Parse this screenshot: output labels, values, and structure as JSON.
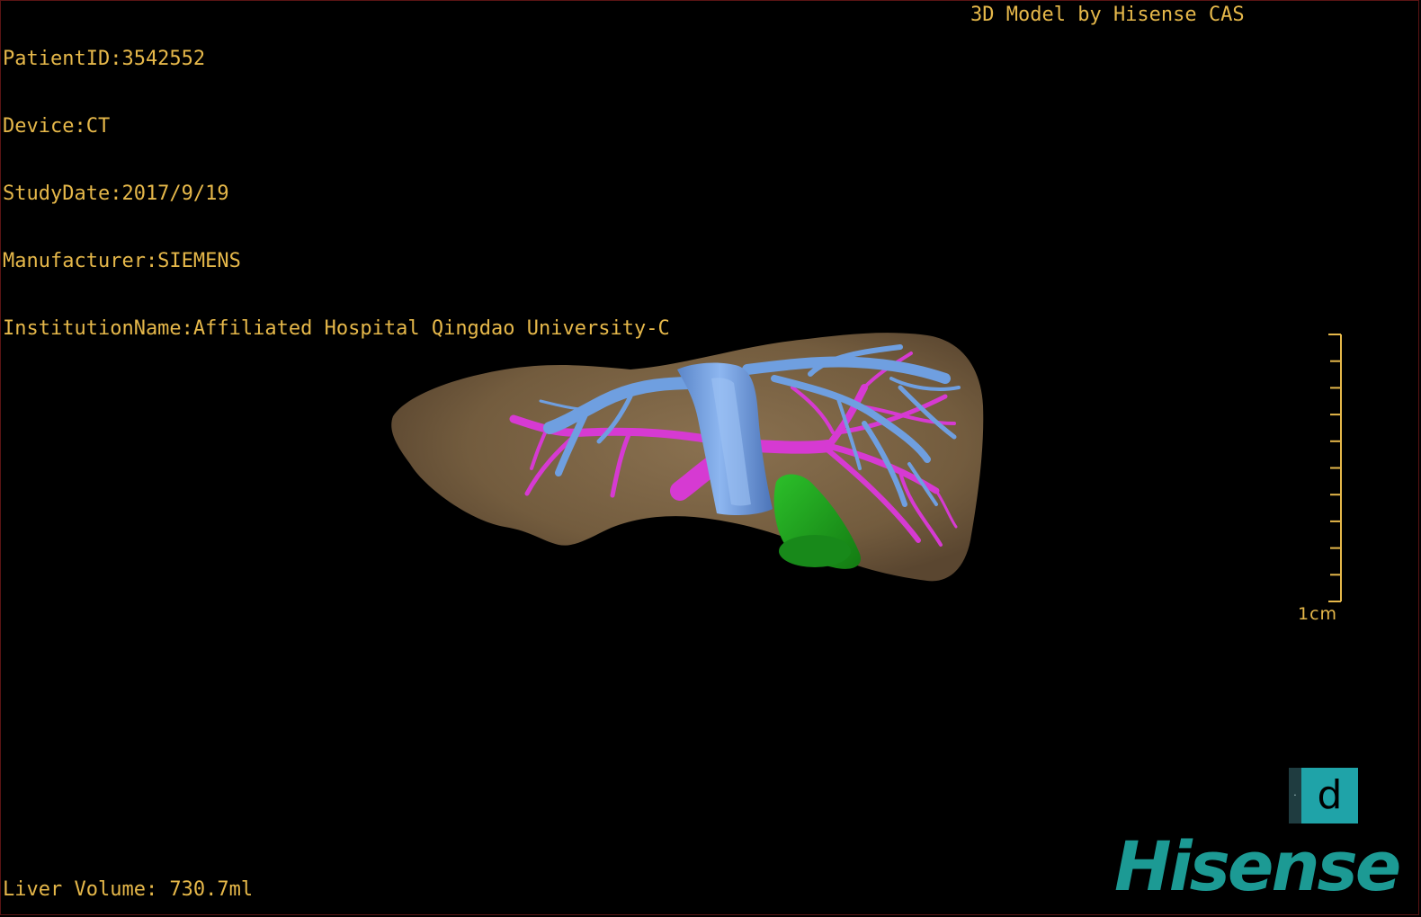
{
  "meta": {
    "patient_id": "PatientID:3542552",
    "device": "Device:CT",
    "study_date": "StudyDate:2017/9/19",
    "manufacturer": "Manufacturer:SIEMENS",
    "institution": "InstitutionName:Affiliated Hospital Qingdao University-C"
  },
  "credit": "3D Model by Hisense CAS",
  "liver_volume": "Liver Volume: 730.7ml",
  "scale": {
    "label": "1cm",
    "tick_count": 11
  },
  "badge": {
    "letter": "d",
    "tab": "·"
  },
  "brand": "Hisense",
  "colors": {
    "overlay_text": "#e6b84a",
    "liver": "#7a6446",
    "hepatic_vein": "#6f9fe0",
    "portal_vein": "#d63ad2",
    "gallbladder": "#1f9a1a",
    "brand": "#1c9a94",
    "badge": "#1fa3a8"
  }
}
